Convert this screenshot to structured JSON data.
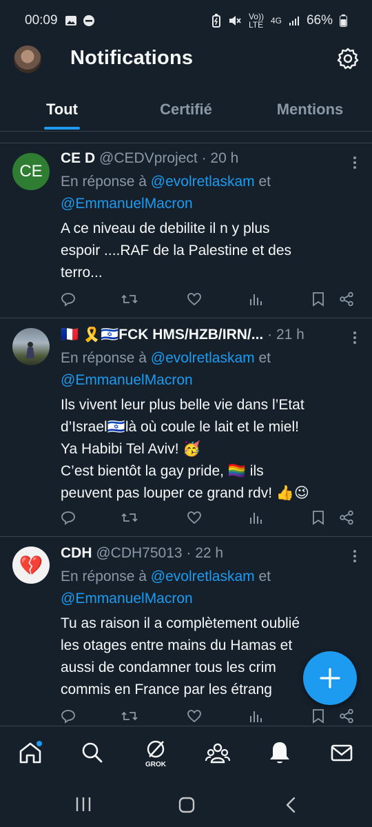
{
  "status_bar": {
    "time": "00:09",
    "net_volte": "Vo)) LTE",
    "net_4g": "4G",
    "battery": "66%"
  },
  "header": {
    "title": "Notifications"
  },
  "tabs": [
    {
      "label": "Tout",
      "active": true
    },
    {
      "label": "Certifié",
      "active": false
    },
    {
      "label": "Mentions",
      "active": false
    }
  ],
  "tweets": [
    {
      "avatar_initials": "CE",
      "avatar_color": "#2e7d32",
      "name": "CE D",
      "handle": "@CEDVproject",
      "time": "· 20 h",
      "reply_prefix": "En réponse à",
      "reply_mention1": "@evolretlaskam",
      "reply_and": "et",
      "reply_mention2": "@EmmanuelMacron",
      "text_lines": [
        "A ce niveau de debilite il n y plus",
        "espoir ....RAF de la Palestine et des",
        "terro..."
      ]
    },
    {
      "avatar_initials": "",
      "name": "🇫🇷 🎗️🇮🇱FCK HMS/HZB/IRN/...",
      "handle": "",
      "time": "· 21 h",
      "reply_prefix": "En réponse à",
      "reply_mention1": "@evolretlaskam",
      "reply_and": "et",
      "reply_mention2": "@EmmanuelMacron",
      "text_lines": [
        "Ils vivent leur plus belle vie dans l’Etat",
        "d’Israel🇮🇱là où coule le lait et le miel!",
        "Ya Habibi Tel Aviv! 🥳",
        "C’est bientôt la gay pride, 🏳️‍🌈 ils",
        "peuvent pas louper ce grand rdv! 👍😉"
      ]
    },
    {
      "avatar_initials": "💔",
      "name": "CDH",
      "handle": "@CDH75013",
      "time": "· 22 h",
      "reply_prefix": "En réponse à",
      "reply_mention1": "@evolretlaskam",
      "reply_and": "et",
      "reply_mention2": "@EmmanuelMacron",
      "text_lines": [
        "Tu as raison il a complètement oublié",
        "les otages entre mains du Hamas et",
        "aussi de condamner tous les crim",
        "commis en France par les étrang"
      ]
    }
  ],
  "bottom_nav": {
    "grok_label": "GROK",
    "items": [
      "home-icon",
      "search-icon",
      "grok-icon",
      "communities-icon",
      "notifications-icon",
      "messages-icon"
    ]
  },
  "icons": {
    "settings": "gear-icon",
    "compose": "plus-icon",
    "reply": "reply-icon",
    "retweet": "retweet-icon",
    "like": "heart-icon",
    "views": "views-icon",
    "bookmark": "bookmark-icon",
    "share": "share-icon"
  },
  "colors": {
    "background": "#15202b",
    "accent": "#1d9bf0",
    "muted": "#8b98a5"
  }
}
